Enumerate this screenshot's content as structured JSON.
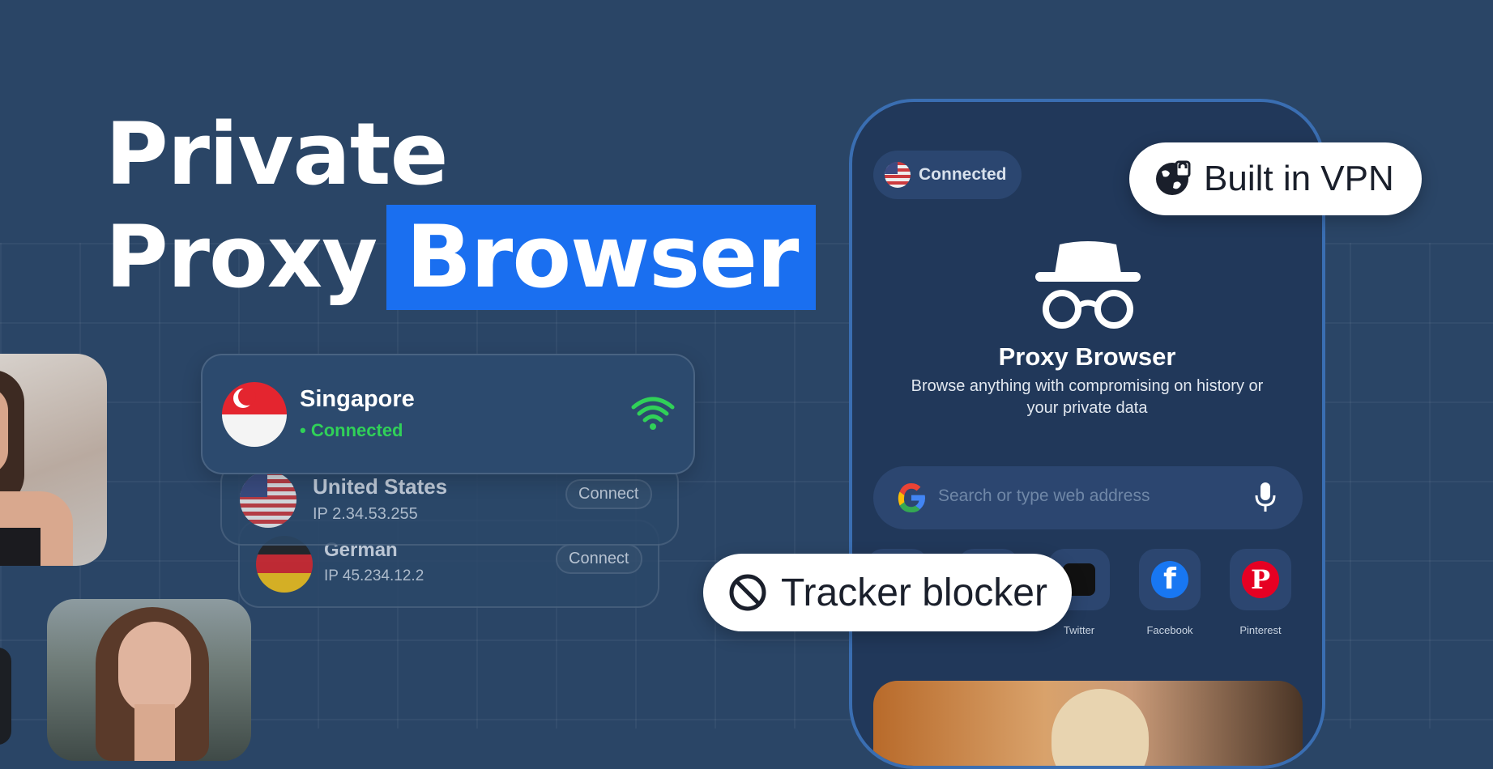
{
  "headline": {
    "line1": "Private",
    "line2_prefix": "Proxy",
    "line2_highlight": "Browser"
  },
  "colors": {
    "background": "#2a4566",
    "highlight": "#1a6ff0",
    "connected_green": "#30d158",
    "phone_border": "#3a6eb2"
  },
  "locations": [
    {
      "name": "Singapore",
      "status": "• Connected",
      "icon": "wifi-signal-icon"
    },
    {
      "name": "United States",
      "ip": "IP 2.34.53.255",
      "button": "Connect"
    },
    {
      "name": "German",
      "ip": "IP 45.234.12.2",
      "button": "Connect"
    }
  ],
  "phone": {
    "status_label": "Connected",
    "app_title": "Proxy Browser",
    "app_description": "Browse anything with compromising on history or your private data",
    "search_placeholder": "Search or type web address",
    "quick_links": [
      {
        "label": "Twitter",
        "icon": "twitter-icon"
      },
      {
        "label": "Facebook",
        "icon": "facebook-icon"
      },
      {
        "label": "Pinterest",
        "icon": "pinterest-icon"
      }
    ]
  },
  "badges": {
    "vpn": "Built in VPN",
    "tracker": "Tracker blocker"
  }
}
